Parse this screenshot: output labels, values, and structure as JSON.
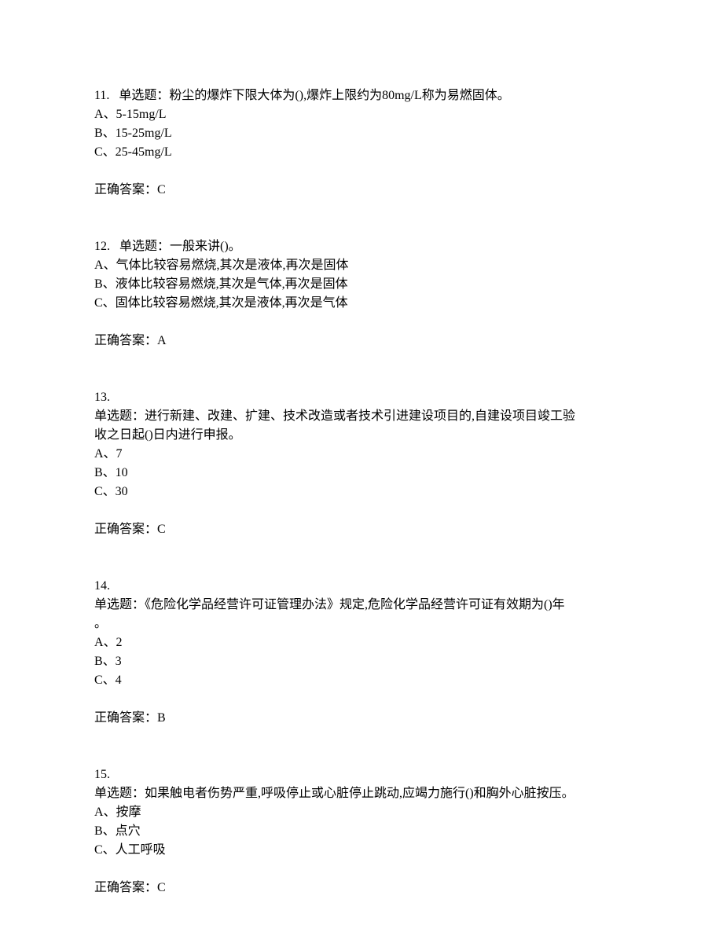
{
  "questions": [
    {
      "number": "11.",
      "type": "单选题：",
      "stem": "粉尘的爆炸下限大体为(),爆炸上限约为80mg/L称为易燃固体。",
      "stemContinuation": "",
      "options": [
        "A、5-15mg/L",
        "B、15-25mg/L",
        "C、25-45mg/L"
      ],
      "answerLabel": "正确答案：",
      "answerValue": "C"
    },
    {
      "number": "12.",
      "type": "单选题：",
      "stem": "一般来讲()。",
      "stemContinuation": "",
      "options": [
        "A、气体比较容易燃烧,其次是液体,再次是固体",
        "B、液体比较容易燃烧,其次是气体,再次是固体",
        "C、固体比较容易燃烧,其次是液体,再次是气体"
      ],
      "answerLabel": "正确答案：",
      "answerValue": "A"
    },
    {
      "number": "13.",
      "type": "单选题：",
      "stem": "进行新建、改建、扩建、技术改造或者技术引进建设项目的,自建设项目竣工验",
      "stemContinuation": "收之日起()日内进行申报。",
      "options": [
        "A、7",
        "B、10",
        "C、30"
      ],
      "answerLabel": "正确答案：",
      "answerValue": "C"
    },
    {
      "number": "14.",
      "type": "单选题：",
      "stem": "《危险化学品经营许可证管理办法》规定,危险化学品经营许可证有效期为()年",
      "stemContinuation": "。",
      "options": [
        "A、2",
        "B、3",
        "C、4"
      ],
      "answerLabel": "正确答案：",
      "answerValue": "B"
    },
    {
      "number": "15.",
      "type": "单选题：",
      "stem": "如果触电者伤势严重,呼吸停止或心脏停止跳动,应竭力施行()和胸外心脏按压。",
      "stemContinuation": "",
      "options": [
        "A、按摩",
        "B、点穴",
        "C、人工呼吸"
      ],
      "answerLabel": "正确答案：",
      "answerValue": "C"
    }
  ]
}
